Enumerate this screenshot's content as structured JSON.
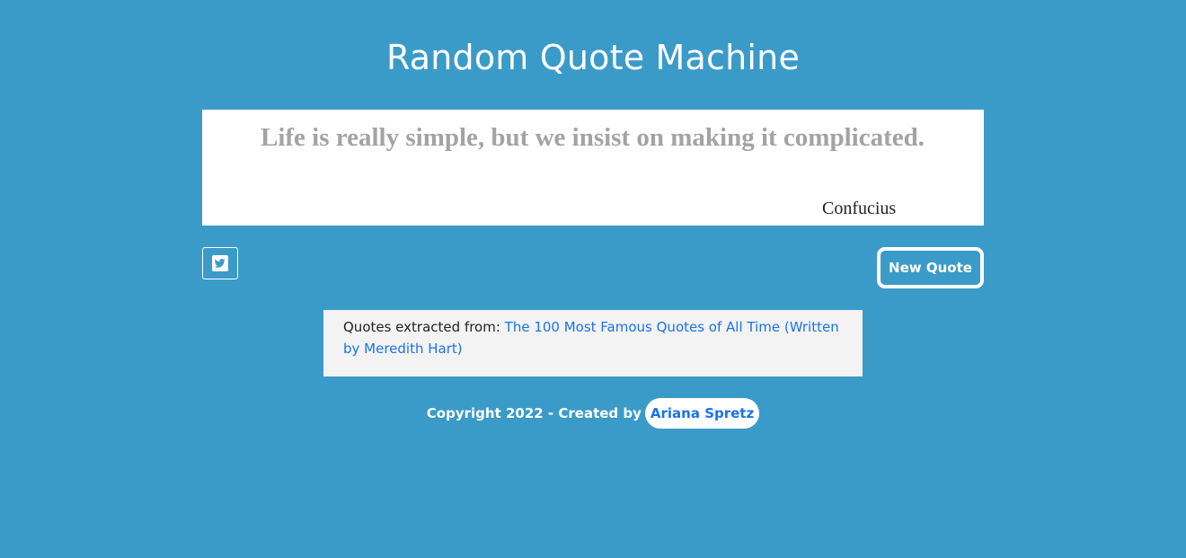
{
  "header": {
    "title": "Random Quote Machine"
  },
  "quote": {
    "text": "Life is really simple, but we insist on making it complicated.",
    "author": "Confucius"
  },
  "actions": {
    "tweet_icon": "twitter-icon",
    "new_quote_label": "New Quote"
  },
  "source": {
    "prefix": "Quotes extracted from: ",
    "link_text": "The 100 Most Famous Quotes of All Time (Written by Meredith Hart)"
  },
  "footer": {
    "text": "Copyright 2022 - Created by",
    "author_link": "Ariana Spretz"
  },
  "colors": {
    "background": "#3b9bc8",
    "quote_text": "#a3a3a3",
    "link": "#1a73e8",
    "source_bg": "#f3f3f3"
  }
}
